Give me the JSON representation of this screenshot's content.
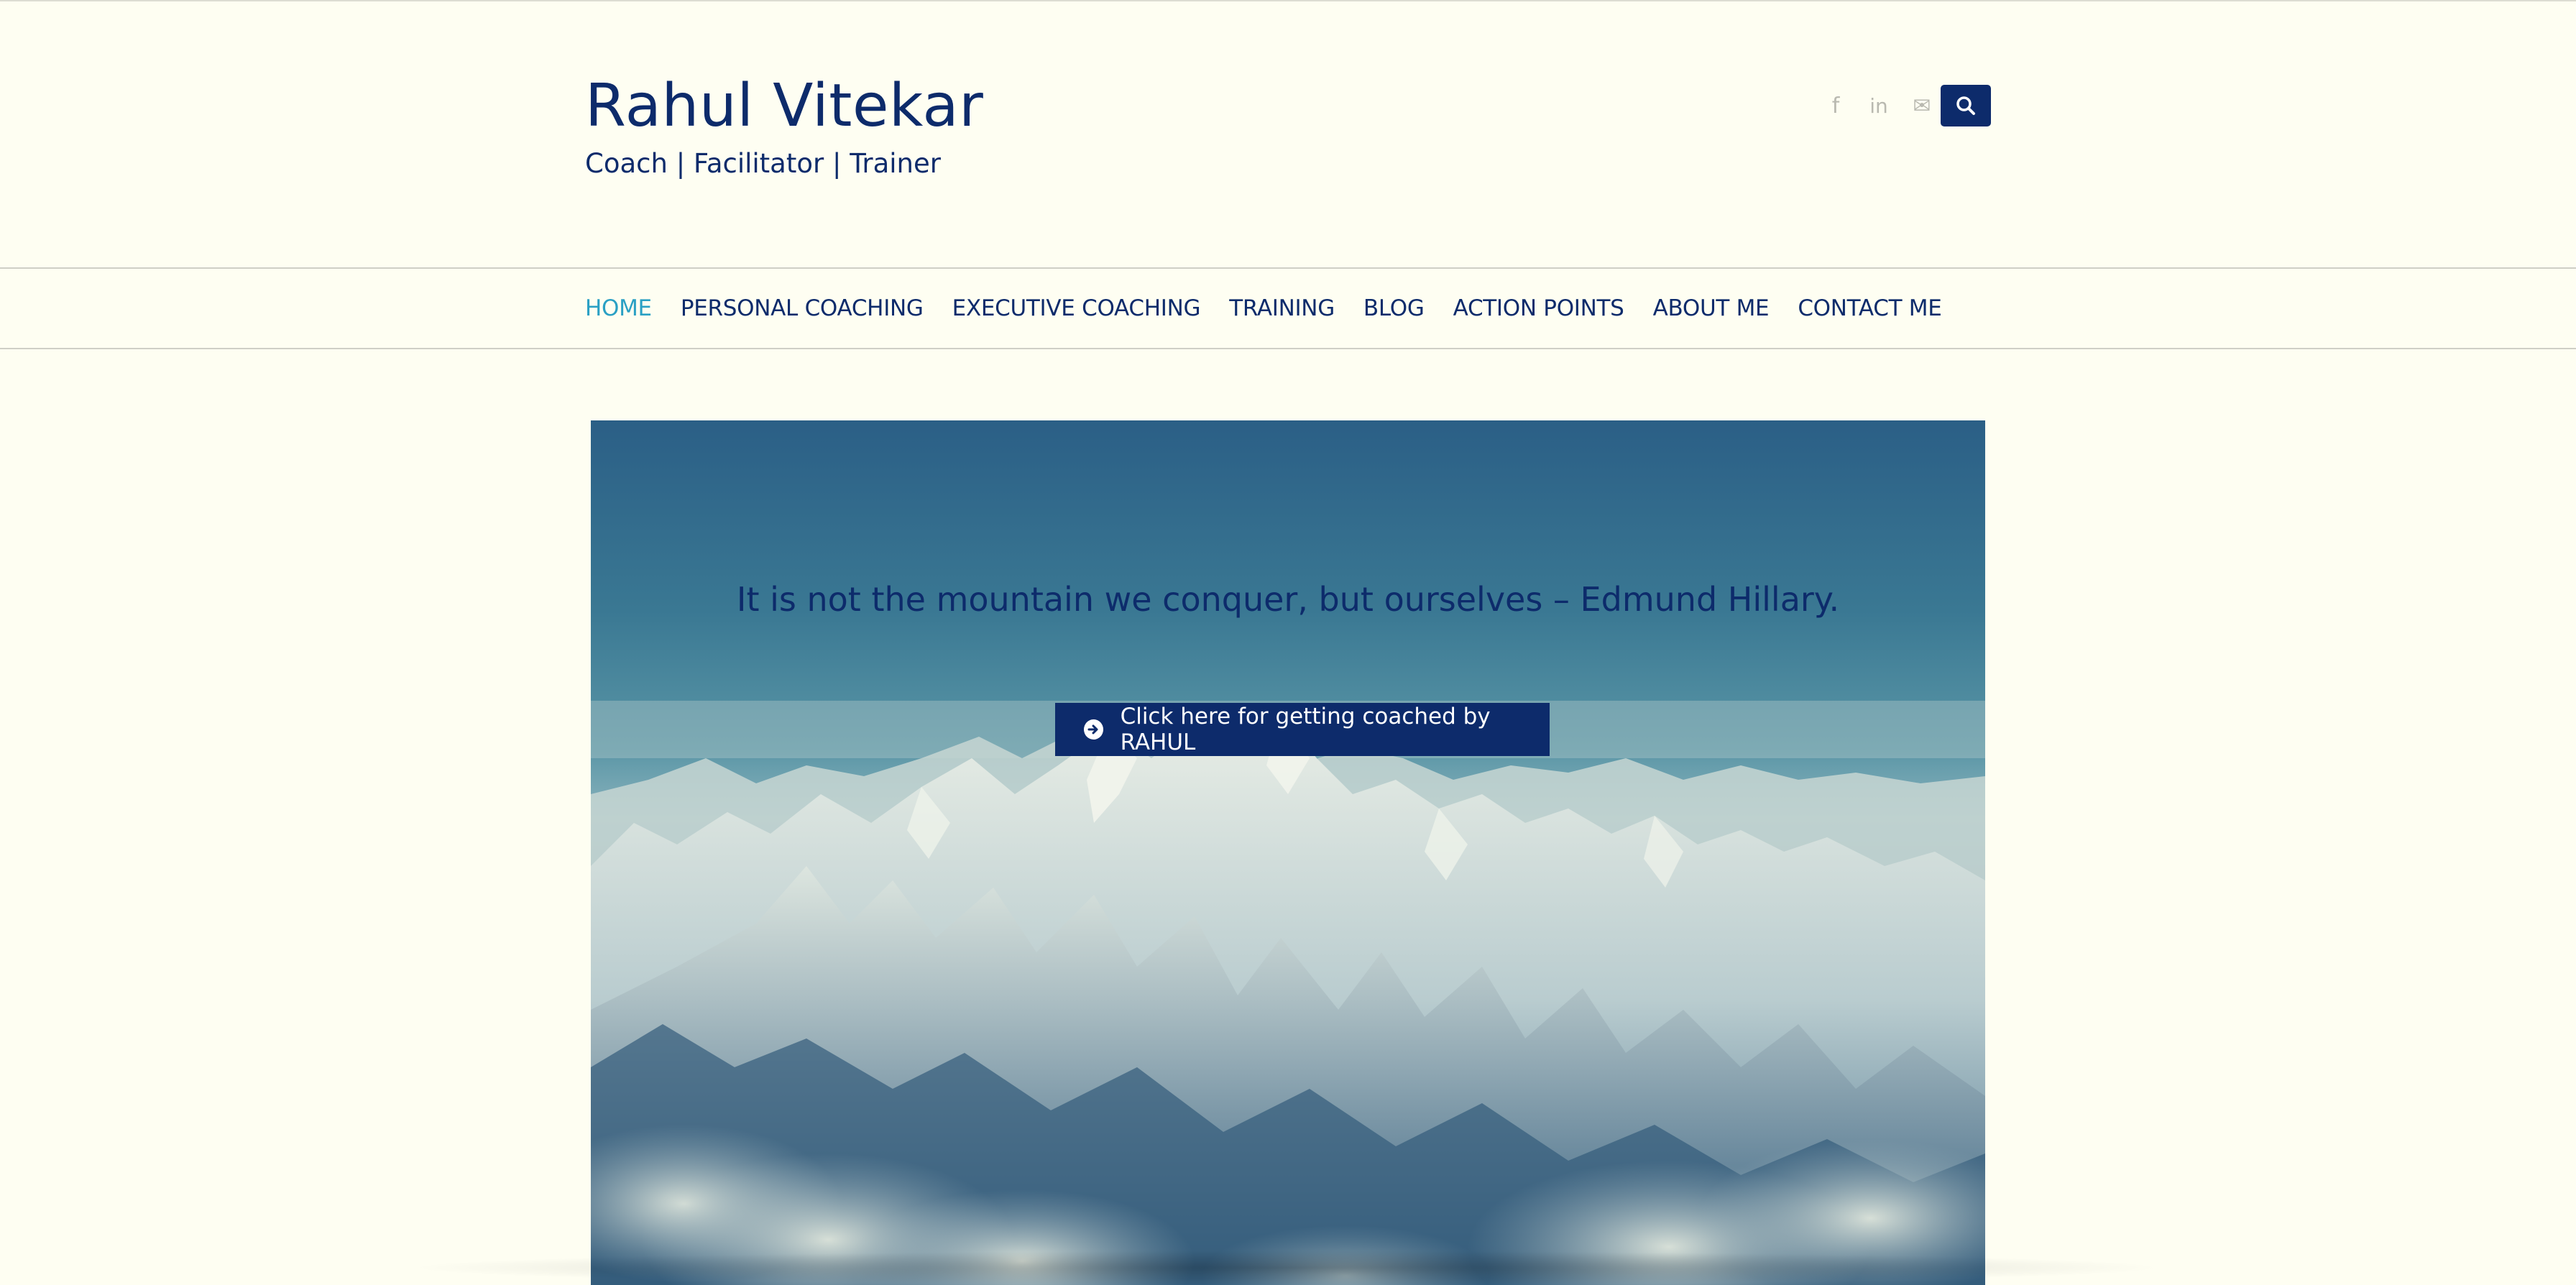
{
  "header": {
    "title": "Rahul Vitekar",
    "tagline": "Coach | Facilitator | Trainer",
    "social": [
      {
        "icon": "facebook-icon",
        "glyph": "f"
      },
      {
        "icon": "linkedin-icon",
        "glyph": "in"
      },
      {
        "icon": "mail-icon",
        "glyph": "✉"
      }
    ],
    "search_icon": "search-icon"
  },
  "nav": {
    "items": [
      {
        "label": "HOME",
        "active": true
      },
      {
        "label": "PERSONAL COACHING",
        "active": false
      },
      {
        "label": "EXECUTIVE COACHING",
        "active": false
      },
      {
        "label": "TRAINING",
        "active": false
      },
      {
        "label": "BLOG",
        "active": false
      },
      {
        "label": "ACTION POINTS",
        "active": false
      },
      {
        "label": "ABOUT ME",
        "active": false
      },
      {
        "label": "CONTACT ME",
        "active": false
      }
    ]
  },
  "hero": {
    "quote": "It is not the mountain we conquer, but ourselves – Edmund Hillary.",
    "cta_label": "Click here for getting coached by RAHUL",
    "cta_icon": "arrow-circle-right-icon"
  },
  "colors": {
    "background": "#fefef2",
    "brand": "#0d2b6b",
    "active_nav": "#2aa0c4"
  }
}
